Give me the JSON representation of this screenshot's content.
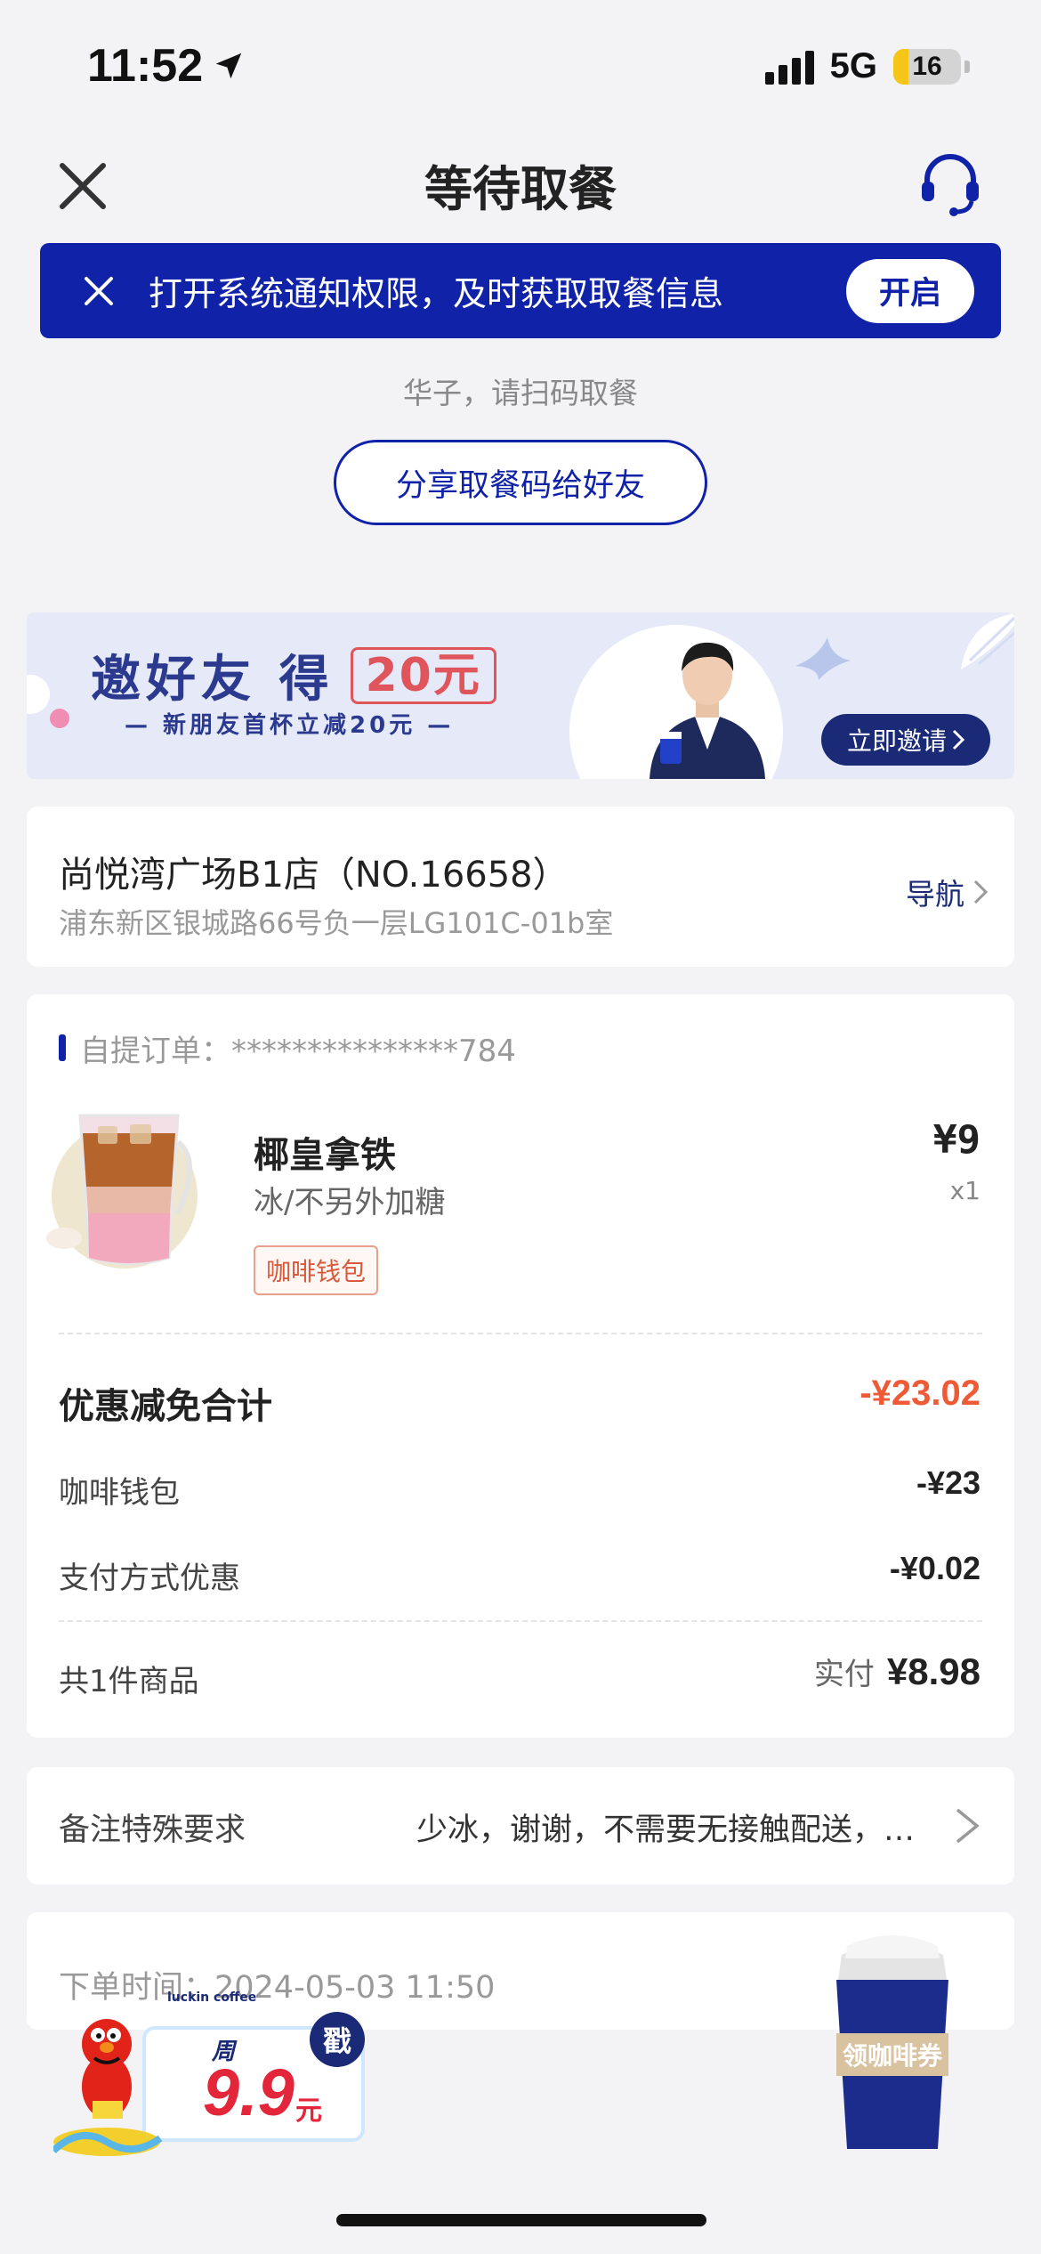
{
  "status_bar": {
    "time": "11:52",
    "network": "5G",
    "battery": "16"
  },
  "header": {
    "title": "等待取餐",
    "close_icon": "close-icon",
    "support_icon": "headset-icon"
  },
  "notification": {
    "text": "打开系统通知权限，及时获取取餐信息",
    "button": "开启"
  },
  "pickup": {
    "greeting": "华子，请扫码取餐",
    "share_button": "分享取餐码给好友"
  },
  "invite_banner": {
    "title": "邀好友 得",
    "amount": "20元",
    "subtitle": "— 新朋友首杯立减20元 —",
    "button": "立即邀请"
  },
  "store": {
    "name": "尚悦湾广场B1店（NO.16658）",
    "address": "浦东新区银城路66号负一层LG101C-01b室",
    "nav": "导航"
  },
  "order": {
    "label": "自提订单：***************784",
    "product": {
      "name": "椰皇拿铁",
      "spec": "冰/不另外加糖",
      "tag": "咖啡钱包",
      "price": "¥9",
      "qty": "x1"
    },
    "discount_total": {
      "label": "优惠减免合计",
      "value": "-¥23.02"
    },
    "wallet": {
      "label": "咖啡钱包",
      "value": "-¥23"
    },
    "payment_discount": {
      "label": "支付方式优惠",
      "value": "-¥0.02"
    },
    "summary": {
      "count": "共1件商品",
      "paid_label": "实付",
      "paid_value": "¥8.98"
    }
  },
  "remark": {
    "label": "备注特殊要求",
    "value": "少冰，谢谢，不需要无接触配送，…"
  },
  "order_time": {
    "label": "下单时间：2024-05-03 11:50"
  },
  "promo": {
    "brand": "luckin coffee",
    "week": "周",
    "price": "9.9",
    "unit": "元",
    "stamp": "戳"
  },
  "coupon": {
    "label": "领咖啡券"
  },
  "colors": {
    "brand_blue": "#0f22a8",
    "discount_red": "#ee5a35",
    "background": "#f3f3f5"
  }
}
